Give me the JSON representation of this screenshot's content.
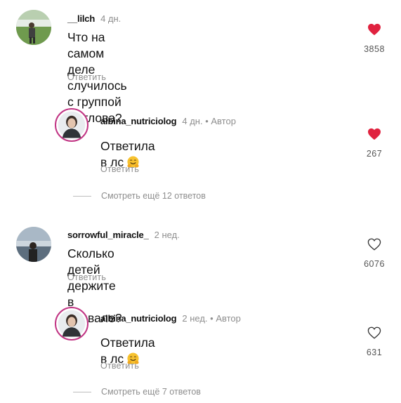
{
  "comments": [
    {
      "username": "__lilch",
      "time": "4 дн.",
      "text_line1": "Что на самом деле случилось с группой",
      "text_line2": "Дятлова?",
      "reply": "Ответить",
      "likes": "3858",
      "liked": true,
      "heart_icon": "heart-filled-icon"
    },
    {
      "username": "albina_nutriciolog",
      "time": "4 дн.",
      "author": "• Автор",
      "text": "Ответила в лс",
      "emoji": "hugging-face-emoji",
      "reply": "Ответить",
      "likes": "267",
      "liked": true,
      "heart_icon": "heart-filled-icon",
      "view_more": "Смотреть ещё 12 ответов"
    },
    {
      "username": "sorrowful_miracle_",
      "time": "2 нед.",
      "text": "Сколько детей держите в подвале?",
      "reply": "Ответить",
      "likes": "6076",
      "liked": false,
      "heart_icon": "heart-outline-icon"
    },
    {
      "username": "albina_nutriciolog",
      "time": "2 нед.",
      "author": "• Автор",
      "text": "Ответила в лс",
      "emoji": "hugging-face-emoji",
      "reply": "Ответить",
      "likes": "631",
      "liked": false,
      "heart_icon": "heart-outline-icon",
      "view_more": "Смотреть ещё 7 ответов"
    }
  ],
  "colors": {
    "heart_liked": "#e0223f",
    "muted_text": "#8e8e8e",
    "author_ring": "#c13584"
  }
}
